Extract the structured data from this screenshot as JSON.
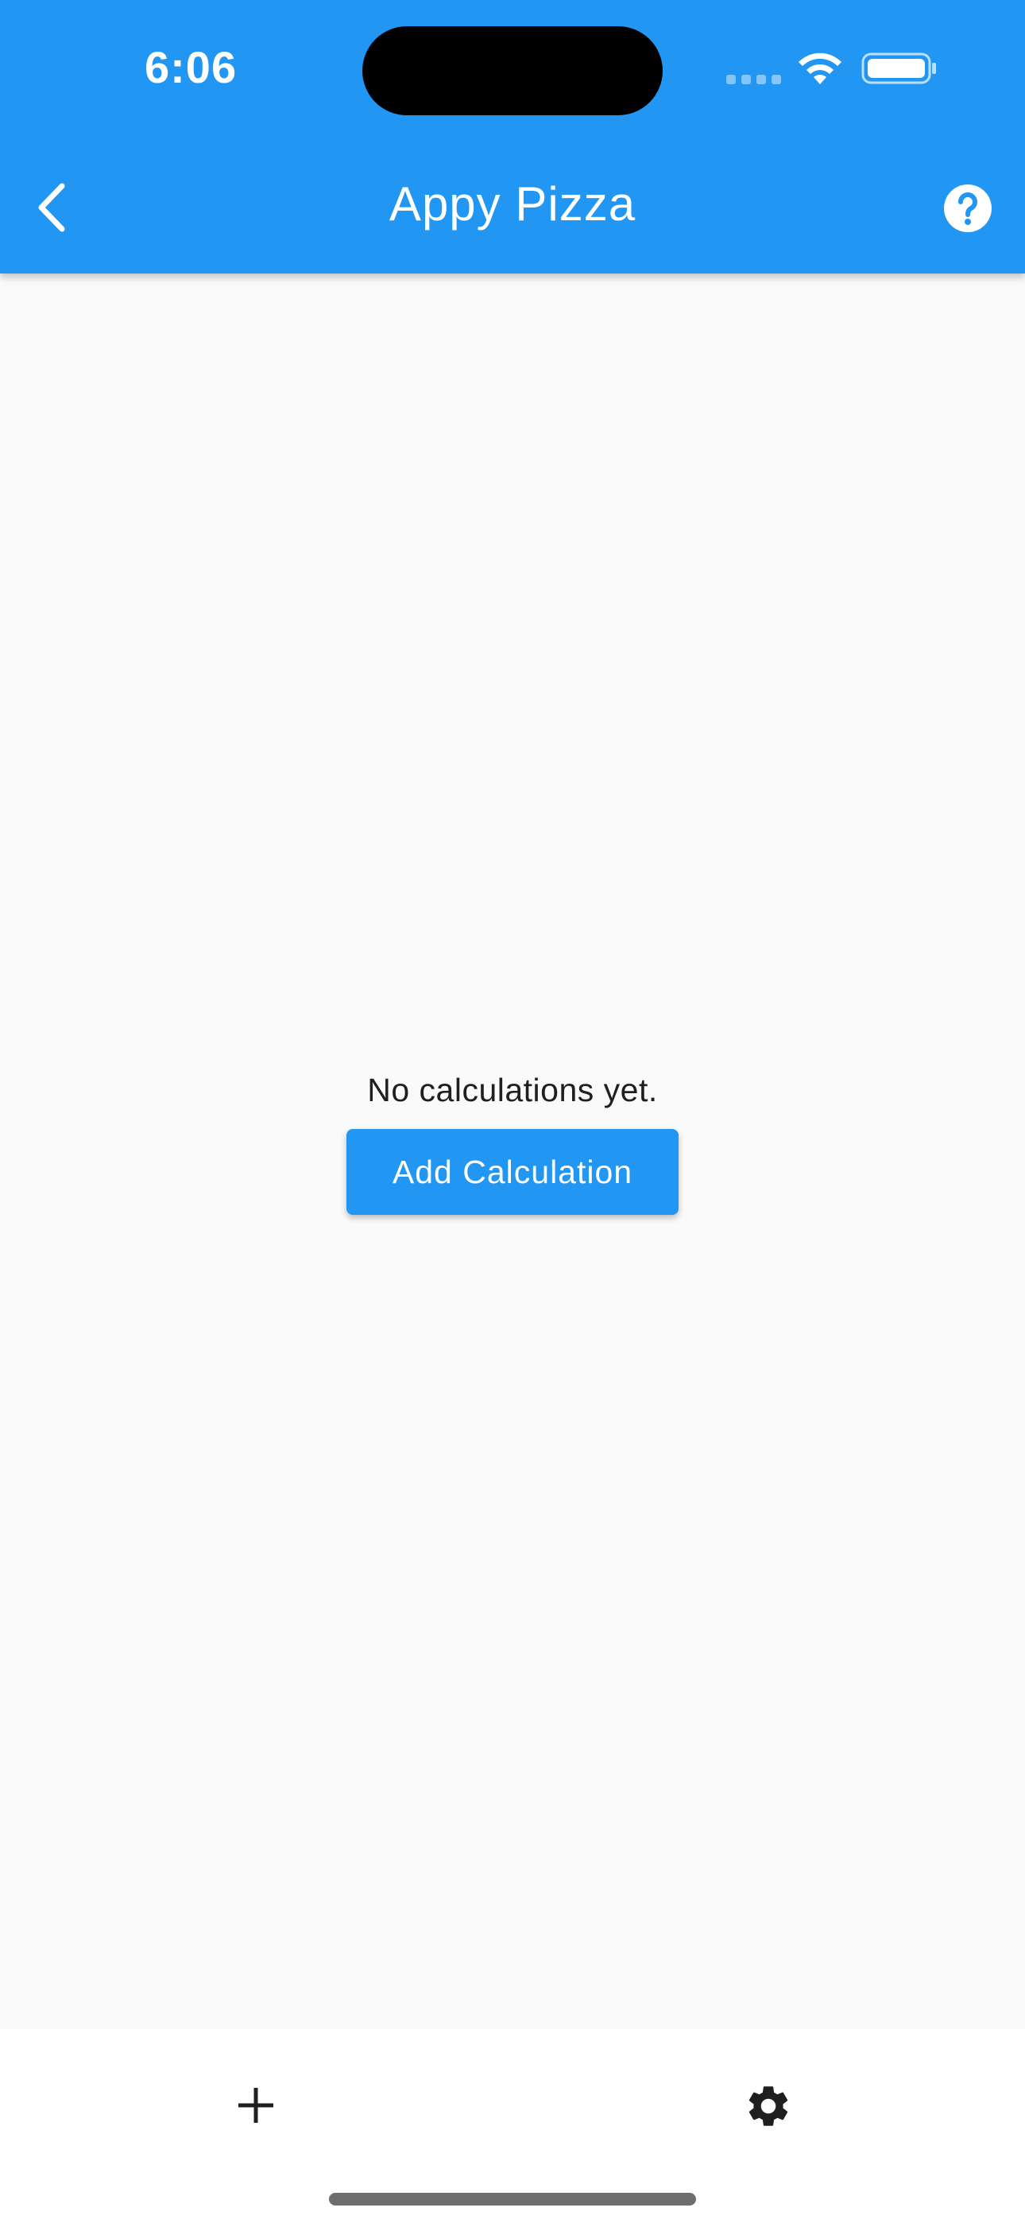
{
  "status_bar": {
    "time": "6:06"
  },
  "app_bar": {
    "title": "Appy Pizza",
    "background_color": "#2196f3",
    "back_icon": "chevron-left-icon",
    "help_icon": "help-circle-icon"
  },
  "empty_state": {
    "message": "No calculations yet.",
    "button_label": "Add Calculation"
  },
  "bottom_bar": {
    "left_icon": "add-icon",
    "right_icon": "gear-icon"
  }
}
